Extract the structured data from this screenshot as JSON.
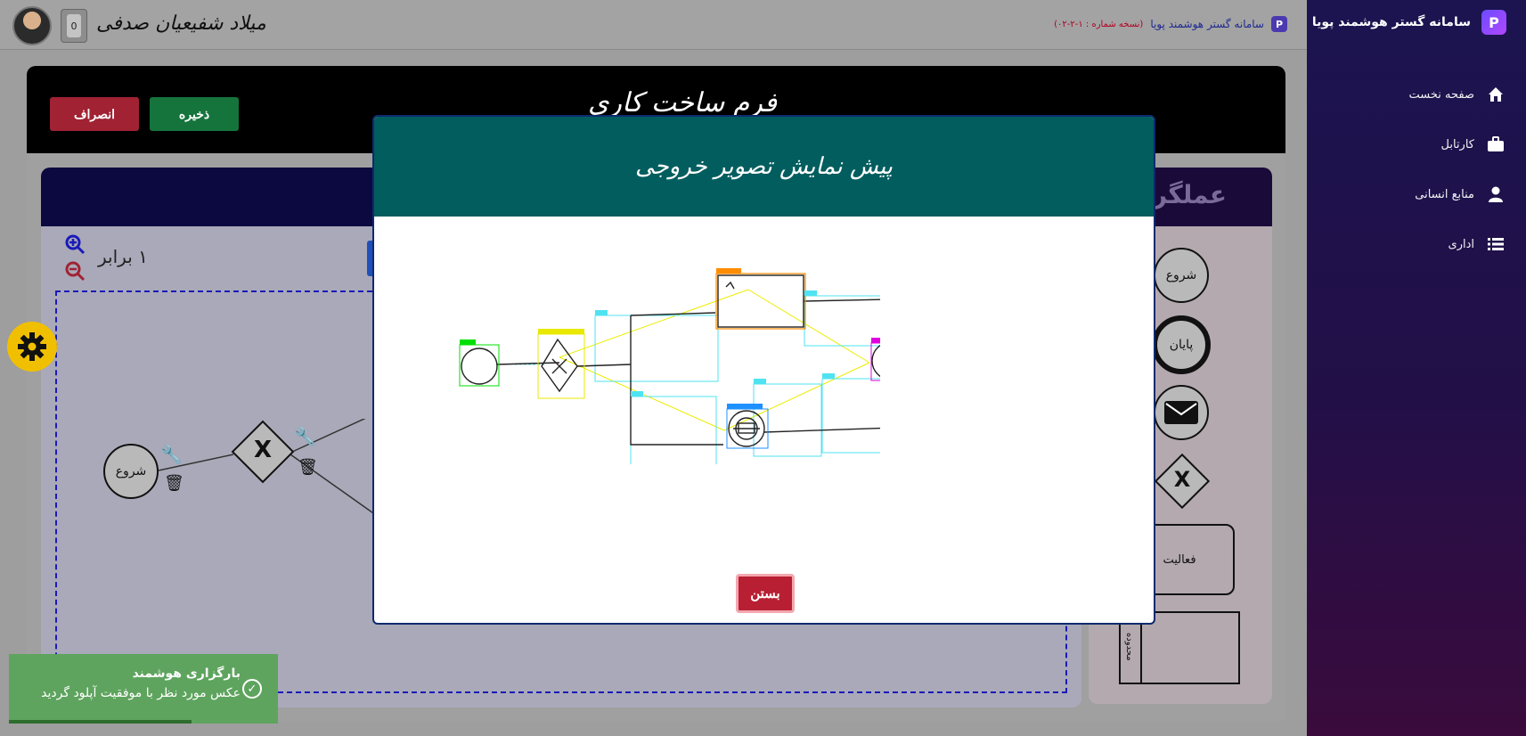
{
  "sidebar": {
    "brand": "سامانه گستر هوشمند پویا",
    "logo_letter": "P",
    "items": [
      {
        "label": "صفحه نخست",
        "icon": "home-icon"
      },
      {
        "label": "کارتابل",
        "icon": "briefcase-icon"
      },
      {
        "label": "منابع انسانی",
        "icon": "user-icon"
      },
      {
        "label": "اداری",
        "icon": "list-icon"
      }
    ]
  },
  "topbar": {
    "user_name": "میلاد شفیعیان صدفی",
    "notification_count": "0",
    "brand": "سامانه گستر هوشمند پویا",
    "version": "(نسخه شماره : ۱-۲-۰۲)"
  },
  "form": {
    "title": "فرم ساخت کاری",
    "save_label": "ذخیره",
    "cancel_label": "انصراف"
  },
  "canvas": {
    "zoom_label": "۱ برابر",
    "start_label": "شروع",
    "gateway_label": "X"
  },
  "toolbox": {
    "title": "عملگر",
    "start_label": "شروع",
    "end_label": "پایان",
    "gateway_label": "X",
    "activity_label": "فعالیت",
    "pool_label": "محدوده"
  },
  "modal": {
    "title": "پیش نمایش تصویر خروجی",
    "close_label": "بستن",
    "detections": [
      {
        "label": "Start",
        "color": "#00e000"
      },
      {
        "label": "ExclusiveGateway",
        "color": "#e8e800"
      },
      {
        "label": "UserTask",
        "color": "#ff8c00"
      },
      {
        "label": "Flow",
        "color": "#00e5ff"
      },
      {
        "label": "MessageThrow",
        "color": "#1e90ff"
      },
      {
        "label": "End",
        "color": "#e000e0"
      }
    ]
  },
  "toast": {
    "title": "بارگزاری هوشمند",
    "message": "عکس مورد نظر با موفقیت آپلود گردید",
    "progress": 0.68
  }
}
